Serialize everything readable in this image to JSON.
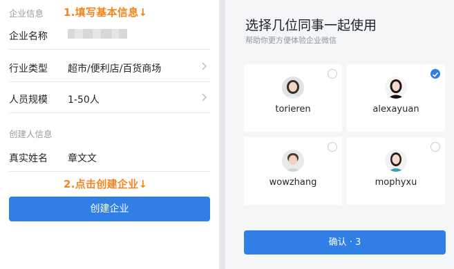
{
  "left": {
    "section_company": "企业信息",
    "annotation_1": "1.填写基本信息↓",
    "annotation_2": "2.点击创建企业↓",
    "fields": {
      "company_name": {
        "label": "企业名称",
        "value": ""
      },
      "industry": {
        "label": "行业类型",
        "value": "超市/便利店/百货商场"
      },
      "size": {
        "label": "人员规模",
        "value": "1-50人"
      }
    },
    "section_creator": "创建人信息",
    "creator_name": {
      "label": "真实姓名",
      "value": "章文文"
    },
    "create_button": "创建企业"
  },
  "right": {
    "title": "选择几位同事一起使用",
    "subtitle": "帮助你更方便体验企业微信",
    "colleagues": [
      {
        "name": "torieren",
        "selected": false
      },
      {
        "name": "alexayuan",
        "selected": true
      },
      {
        "name": "wowzhang",
        "selected": false
      },
      {
        "name": "mophyxu",
        "selected": false
      }
    ],
    "confirm_button": "确认 · 3"
  },
  "colors": {
    "primary": "#2f7fe6",
    "annotation": "#f5841f"
  },
  "icons": [
    "chevron-right-icon",
    "check-icon"
  ]
}
